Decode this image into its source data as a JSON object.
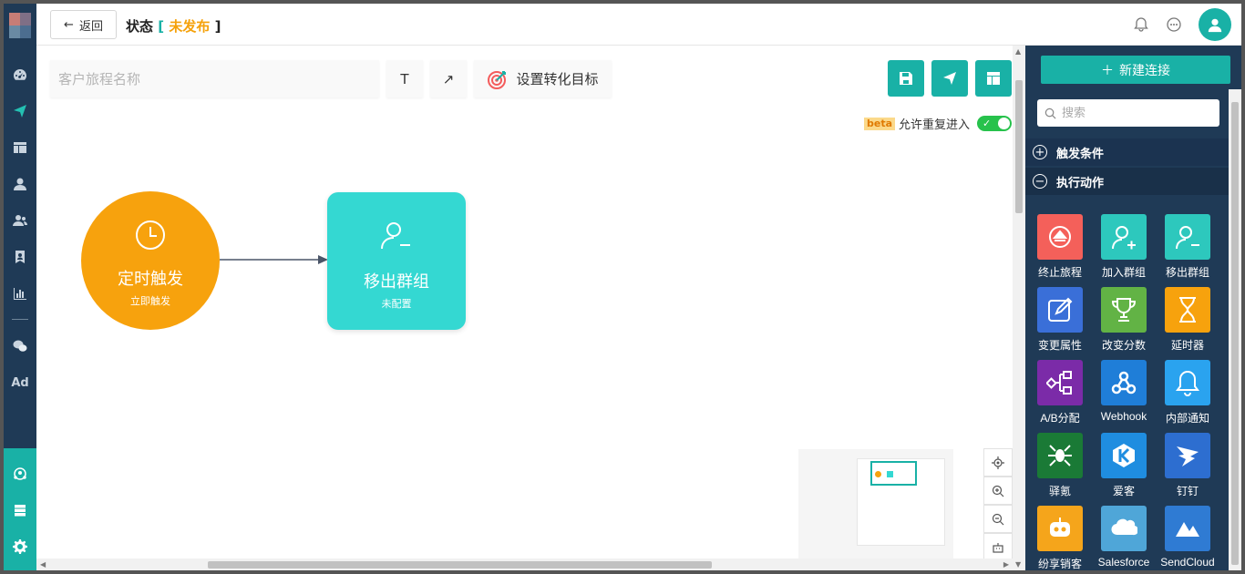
{
  "header": {
    "back_label": "返回",
    "status_label": "状态",
    "status_value": "未发布",
    "bracket_open": "[",
    "bracket_close": "]"
  },
  "toolbar": {
    "name_placeholder": "客户旅程名称",
    "text_tool": "T",
    "arrow_tool": "↗",
    "goal_label": "设置转化目标"
  },
  "beta_row": {
    "badge": "beta",
    "label": "允许重复进入",
    "enabled": true
  },
  "canvas": {
    "trigger_node": {
      "title": "定时触发",
      "subtitle": "立即触发",
      "color": "#f7a20d"
    },
    "action_node": {
      "title": "移出群组",
      "subtitle": "未配置",
      "color": "#34d8d2"
    }
  },
  "right_panel": {
    "new_connection_label": "新建连接",
    "search_placeholder": "搜索",
    "sections": [
      {
        "label": "触发条件",
        "state": "collapsed"
      },
      {
        "label": "执行动作",
        "state": "expanded"
      }
    ],
    "actions": [
      {
        "label": "终止旅程",
        "icon": "stop-journey-icon",
        "color": "#f4605a"
      },
      {
        "label": "加入群组",
        "icon": "user-add-icon",
        "color": "#2dc8bd"
      },
      {
        "label": "移出群组",
        "icon": "user-remove-icon",
        "color": "#2dc8bd"
      },
      {
        "label": "变更属性",
        "icon": "edit-icon",
        "color": "#3a6fd8"
      },
      {
        "label": "改变分数",
        "icon": "trophy-icon",
        "color": "#62b345"
      },
      {
        "label": "延时器",
        "icon": "hourglass-icon",
        "color": "#f7a20d"
      },
      {
        "label": "A/B分配",
        "icon": "ab-split-icon",
        "color": "#7b2ba8"
      },
      {
        "label": "Webhook",
        "icon": "webhook-icon",
        "color": "#1f7ed8"
      },
      {
        "label": "内部通知",
        "icon": "bell-icon",
        "color": "#2aa3ef"
      },
      {
        "label": "驿氪",
        "icon": "spider-icon",
        "color": "#1a7a36"
      },
      {
        "label": "爱客",
        "icon": "k-icon",
        "color": "#1f8de0"
      },
      {
        "label": "钉钉",
        "icon": "dingtalk-icon",
        "color": "#2d6ed0"
      },
      {
        "label": "纷享销客",
        "icon": "robot-icon",
        "color": "#f5a51b"
      },
      {
        "label": "Salesforce",
        "icon": "cloud-icon",
        "color": "#4fa6d8"
      },
      {
        "label": "SendCloud",
        "icon": "sendcloud-icon",
        "color": "#2f7bd3"
      }
    ]
  },
  "colors": {
    "nav_bg": "#1f3a56",
    "accent": "#19b1a6",
    "pending": "#f5a10a"
  }
}
